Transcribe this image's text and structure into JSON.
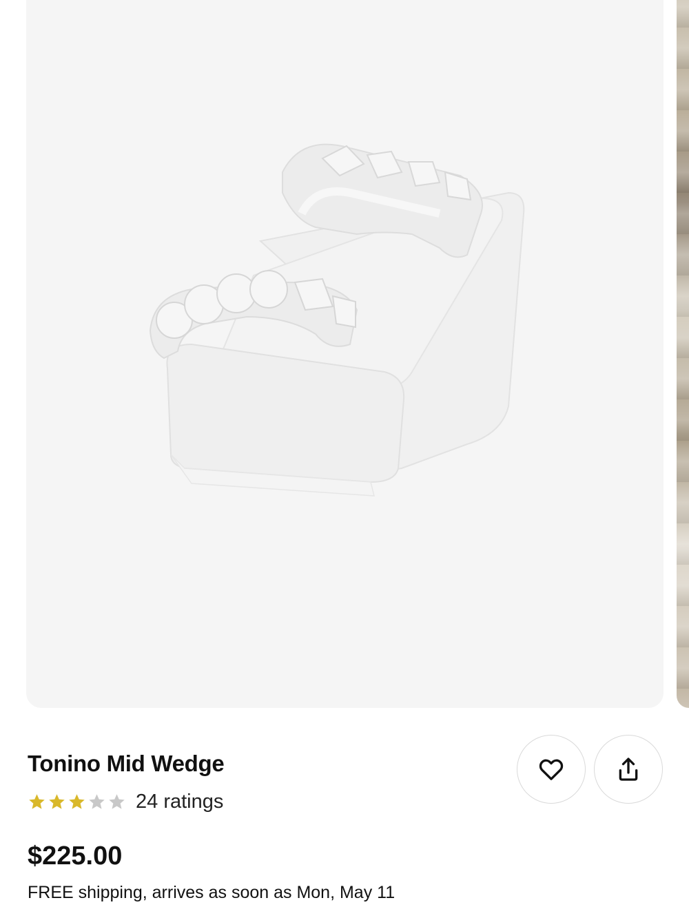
{
  "product": {
    "title": "Tonino Mid Wedge",
    "rating": 3,
    "rating_max": 5,
    "ratings_label": "24 ratings",
    "price": "$225.00",
    "shipping": "FREE shipping, arrives as soon as Mon, May 11"
  },
  "colors": {
    "star_filled": "#d9b82a",
    "star_empty": "#c8c8c8",
    "image_background": "#f5f5f5"
  },
  "icons": {
    "favorite": "heart-icon",
    "share": "share-icon"
  }
}
